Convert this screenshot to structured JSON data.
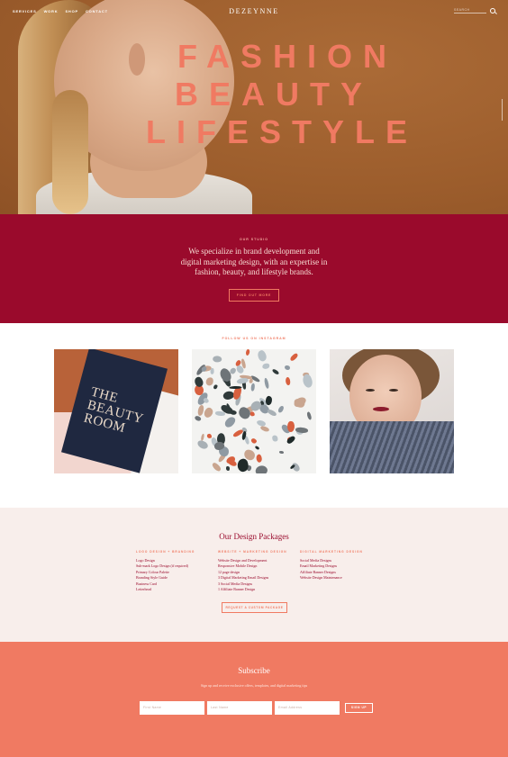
{
  "nav": {
    "items": [
      "SERVICES",
      "WORK",
      "SHOP",
      "CONTACT"
    ],
    "logo": "DEZEYNNE",
    "search_placeholder": "SEARCH"
  },
  "hero": {
    "lines": [
      "FASHION",
      "BEAUTY",
      "LIFESTYLE"
    ]
  },
  "studio": {
    "eyebrow": "OUR STUDIO",
    "text": "We specialize in brand development and digital marketing design, with an expertise in fashion, beauty, and lifestyle brands.",
    "button": "FIND OUT MORE"
  },
  "instagram": {
    "eyebrow": "FOLLOW US ON INSTAGRAM",
    "card_text": [
      "THE",
      "BEAUTY",
      "ROOM"
    ]
  },
  "packages": {
    "title": "Our Design Packages",
    "columns": [
      {
        "heading": "LOGO DESIGN + BRANDING",
        "items": [
          "Logo Design",
          "Sub-mark Logo Design (if required)",
          "Primary Colour Palette",
          "Branding Style Guide",
          "Business Card",
          "Letterhead"
        ]
      },
      {
        "heading": "WEBSITE + MARKETING DESIGN",
        "items": [
          "Website Design and Development",
          "Responsive Mobile Design",
          "12 page design",
          "3 Digital Marketing Email Designs",
          "3 Social Media Designs",
          "1 Affiliate Banner Design"
        ]
      },
      {
        "heading": "DIGITAL MARKETING DESIGN",
        "items": [
          "Social Media Designs",
          "Email Marketing Designs",
          "Affiliate Banner Designs",
          "Website Design Maintenance"
        ]
      }
    ],
    "button": "REQUEST A CUSTOM PACKAGE"
  },
  "subscribe": {
    "title": "Subscribe",
    "text": "Sign up and receive exclusive offers, templates, and digital marketing tips",
    "fields": [
      "First Name",
      "Last Name",
      "Email Address"
    ],
    "button": "SIGN UP"
  },
  "colors": {
    "brand_red": "#9a0a2c",
    "coral": "#f07a62",
    "hero_brown": "#a0612f",
    "blush": "#f8eeeb"
  }
}
